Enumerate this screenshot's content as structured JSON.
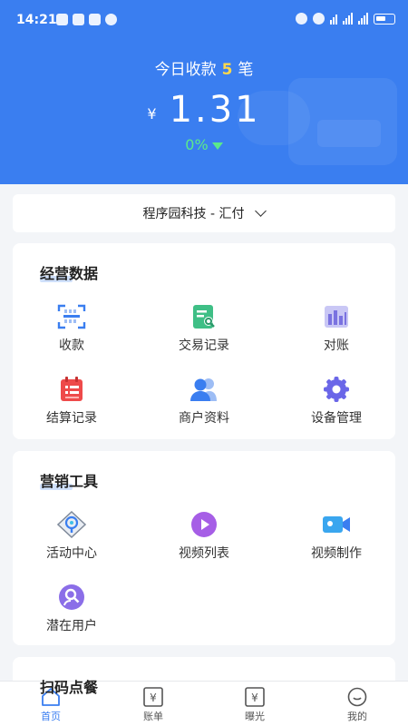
{
  "status_bar": {
    "time": "14:21"
  },
  "summary": {
    "today_prefix": "今日收款",
    "today_count": "5",
    "today_suffix": "笔",
    "currency": "¥",
    "amount": "1.31",
    "change": "0%"
  },
  "merchant": {
    "name": "程序园科技 - 汇付"
  },
  "business": {
    "title": "经营数据",
    "items": [
      {
        "label": "收款",
        "icon": "scan-icon"
      },
      {
        "label": "交易记录",
        "icon": "transaction-search-icon"
      },
      {
        "label": "对账",
        "icon": "bar-chart-icon"
      },
      {
        "label": "结算记录",
        "icon": "calendar-list-icon"
      },
      {
        "label": "商户资料",
        "icon": "users-icon"
      },
      {
        "label": "设备管理",
        "icon": "gear-icon"
      }
    ]
  },
  "marketing": {
    "title": "营销工具",
    "items": [
      {
        "label": "活动中心",
        "icon": "activity-icon"
      },
      {
        "label": "视频列表",
        "icon": "play-icon"
      },
      {
        "label": "视频制作",
        "icon": "video-camera-icon"
      },
      {
        "label": "潜在用户",
        "icon": "user-search-icon"
      }
    ]
  },
  "next_section": {
    "title": "扫码点餐"
  },
  "tabbar": [
    {
      "label": "首页",
      "icon": "home-icon",
      "active": true
    },
    {
      "label": "账单",
      "icon": "bill-icon"
    },
    {
      "label": "曝光",
      "icon": "exposure-icon"
    },
    {
      "label": "我的",
      "icon": "profile-icon"
    }
  ],
  "colors": {
    "primary": "#3a7ef0",
    "up": "#5bea8a",
    "count": "#ffd84a"
  }
}
